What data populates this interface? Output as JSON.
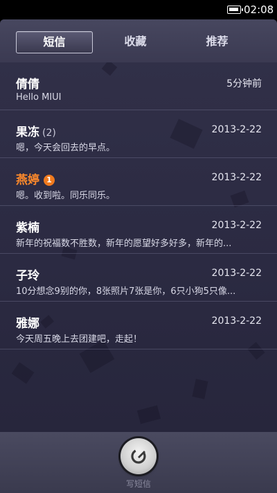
{
  "status_bar": {
    "time": "02:08"
  },
  "tabs": [
    {
      "label": "短信",
      "active": true
    },
    {
      "label": "收藏",
      "active": false
    },
    {
      "label": "推荐",
      "active": false
    }
  ],
  "messages": [
    {
      "name": "倩倩",
      "count": "",
      "badge": "",
      "time": "5分钟前",
      "preview": "Hello MIUI",
      "highlight": false
    },
    {
      "name": "果冻",
      "count": "(2)",
      "badge": "",
      "time": "2013-2-22",
      "preview": "嗯，今天会回去的早点。",
      "highlight": false
    },
    {
      "name": "燕婷",
      "count": "",
      "badge": "1",
      "time": "2013-2-22",
      "preview": "嗯。收到啦。同乐同乐。",
      "highlight": true
    },
    {
      "name": "紫楠",
      "count": "",
      "badge": "",
      "time": "2013-2-22",
      "preview": "新年的祝福数不胜数，新年的愿望好多好多，新年的...",
      "highlight": false
    },
    {
      "name": "子玲",
      "count": "",
      "badge": "",
      "time": "2013-2-22",
      "preview": "10分想念9别的你，8张照片7张是你，6只小狗5只像...",
      "highlight": false
    },
    {
      "name": "雅娜",
      "count": "",
      "badge": "",
      "time": "2013-2-22",
      "preview": "今天周五晚上去团建吧，走起！",
      "highlight": false
    }
  ],
  "bottom_bar": {
    "compose_label": "写短信"
  },
  "colors": {
    "accent": "#ff8a2b",
    "badge": "#f07a1e",
    "panel": "#2c2b43"
  },
  "icons": {
    "compose": "compose-icon",
    "battery": "battery-icon"
  }
}
